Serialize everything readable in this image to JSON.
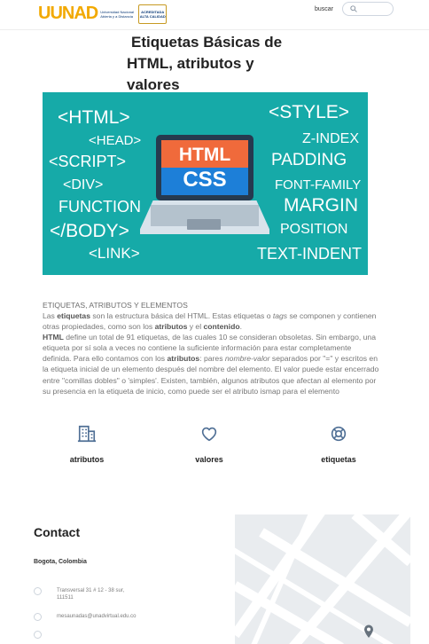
{
  "header": {
    "logo_text": "UNAD",
    "logo_subtitle": "Universidad Nacional Abierta y a Distancia",
    "accreditation": "ACREDITADA ALTA CALIDAD",
    "search_label": "buscar"
  },
  "page": {
    "title_line1": "Etiquetas Básicas de",
    "title_line2": "HTML, atributos y",
    "title_line3": "valores"
  },
  "hero": {
    "left_tags": [
      "<HTML>",
      "<HEAD>",
      "<SCRIPT>",
      "<DIV>",
      "FUNCTION",
      "</BODY>",
      "<LINK>"
    ],
    "right_tags": [
      "<STYLE>",
      "Z-INDEX",
      "PADDING",
      "FONT-FAMILY",
      "MARGIN",
      "POSITION",
      "TEXT-INDENT"
    ],
    "screen_top": "HTML",
    "screen_bottom": "CSS"
  },
  "content": {
    "heading": "ETIQUETAS, ATRIBUTOS Y ELEMENTOS",
    "p1_a": "Las ",
    "p1_b": "etiquetas",
    "p1_c": " son la estructura básica del HTML. Estas etiquetas o ",
    "p1_d": "tags",
    "p1_e": " se componen y contienen otras propiedades, como son los ",
    "p1_f": "atributos",
    "p1_g": " y el ",
    "p1_h": "contenido",
    "p1_i": ".",
    "p2_a": "HTML",
    "p2_b": " define un total de 91 etiquetas, de las cuales 10 se consideran obsoletas. Sin embargo, una etiqueta por sí sola a veces no contiene la suficiente información para estar completamente definida. Para ello contamos con los ",
    "p2_c": "atributos",
    "p2_d": ": pares ",
    "p2_e": "nombre-valor",
    "p2_f": " separados por \"=\" y escritos en la etiqueta inicial de un elemento después del nombre del elemento. El valor puede estar encerrado entre \"comillas dobles\" o 'simples'. Existen, también, algunos atributos que afectan al elemento por su presencia en la etiqueta de inicio, como puede ser el atributo ismap para el elemento"
  },
  "features": [
    {
      "label": "atributos",
      "icon": "building-icon"
    },
    {
      "label": "valores",
      "icon": "heart-icon"
    },
    {
      "label": "etiquetas",
      "icon": "lifebuoy-icon"
    }
  ],
  "contact": {
    "title": "Contact",
    "city": "Bogota, Colombia",
    "address": "Transversal 31 # 12 - 38 sur, 111511",
    "email": "mesaunadas@unadvirtual.edu.co"
  },
  "colors": {
    "hero_bg": "#16aaa8",
    "html_orange": "#f06a3b",
    "css_blue": "#1d7fd8",
    "brand_blue": "#0b3a78",
    "brand_gold": "#f2a900"
  }
}
